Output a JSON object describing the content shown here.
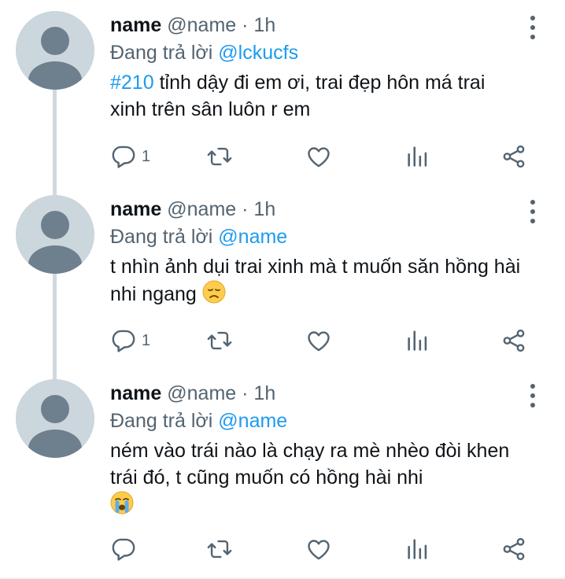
{
  "tweets": [
    {
      "name": "name",
      "handle": "@name",
      "dot": "·",
      "time": "1h",
      "reply_prefix": "Đang trả lời",
      "reply_to": "@lckucfs",
      "hashtag": "#210",
      "text_after_hashtag": " tỉnh dậy đi em ơi, trai đẹp hôn má trai xinh trên sân luôn r em",
      "reply_count": "1",
      "emoji": ""
    },
    {
      "name": "name",
      "handle": "@name",
      "dot": "·",
      "time": "1h",
      "reply_prefix": "Đang trả lời",
      "reply_to": "@name",
      "text": "t nhìn ảnh dụi trai xinh mà t muốn săn hồng hài nhi ngang ",
      "reply_count": "1",
      "emoji": "disappointed-face"
    },
    {
      "name": "name",
      "handle": "@name",
      "dot": "·",
      "time": "1h",
      "reply_prefix": "Đang trả lời",
      "reply_to": "@name",
      "text": "ném vào trái nào là chạy ra mè nhèo đòi khen trái đó, t cũng muốn có hồng hài nhi",
      "reply_count": "",
      "emoji": "loudly-crying-face"
    }
  ],
  "icons": {
    "reply": "reply-icon",
    "retweet": "retweet-icon",
    "like": "heart-icon",
    "views": "analytics-icon",
    "share": "share-icon",
    "more": "more-vertical-icon"
  },
  "colors": {
    "link": "#1d9bf0",
    "secondary_text": "#536471",
    "avatar_bg": "#ccd6dd",
    "avatar_fg": "#6e7f8d",
    "thread_line": "#cfd9de"
  }
}
